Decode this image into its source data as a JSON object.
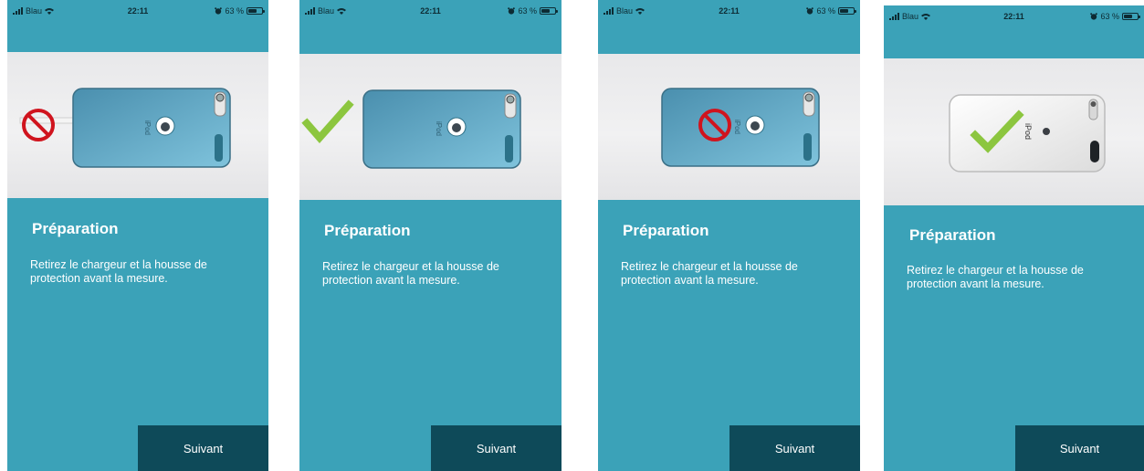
{
  "status_bar": {
    "carrier": "Blau",
    "time": "22:11",
    "battery": "63 %",
    "battery_level": 0.63,
    "icons": [
      "signal-bars-icon",
      "wifi-icon",
      "alarm-icon",
      "battery-icon"
    ]
  },
  "colors": {
    "background": "#3ba2b8",
    "button": "#0e4a59",
    "text": "#ffffff",
    "allowed_mark": "#8cc63f",
    "forbidden_mark": "#d0141e"
  },
  "screens": [
    {
      "title": "Préparation",
      "description": "Retirez le chargeur et la housse de protection avant la mesure.",
      "next_label": "Suivant",
      "illustration": {
        "device_label": "iPod",
        "case": true,
        "cable": true,
        "marker": "forbidden-icon"
      }
    },
    {
      "title": "Préparation",
      "description": "Retirez le chargeur et la housse de protection avant la mesure.",
      "next_label": "Suivant",
      "illustration": {
        "device_label": "iPod",
        "case": true,
        "cable": false,
        "marker": "checkmark-icon"
      }
    },
    {
      "title": "Préparation",
      "description": "Retirez le chargeur et la housse de protection avant la mesure.",
      "next_label": "Suivant",
      "illustration": {
        "device_label": "iPod",
        "case": true,
        "cable": false,
        "marker": "forbidden-icon"
      }
    },
    {
      "title": "Préparation",
      "description": "Retirez le chargeur et la housse de protection avant la mesure.",
      "next_label": "Suivant",
      "illustration": {
        "device_label": "iPod",
        "case": false,
        "cable": false,
        "marker": "checkmark-icon"
      }
    }
  ]
}
